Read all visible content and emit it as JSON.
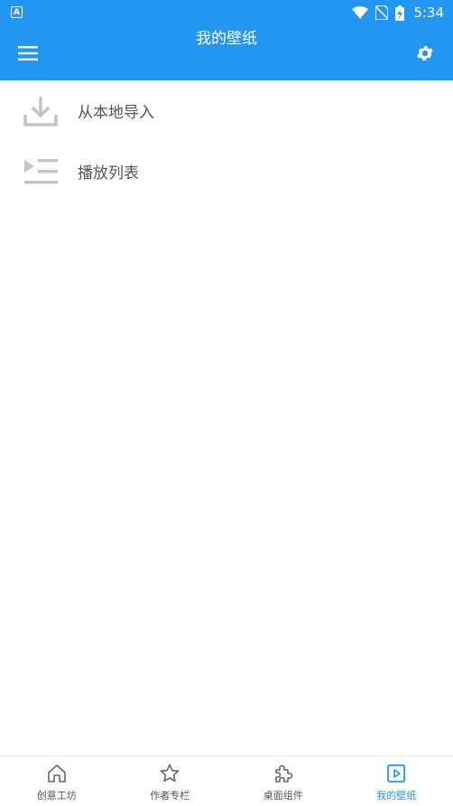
{
  "status_bar": {
    "notification_icon": "A",
    "time": "5:34"
  },
  "app_bar": {
    "title": "我的壁纸"
  },
  "list": [
    {
      "label": "从本地导入",
      "icon": "download-icon"
    },
    {
      "label": "播放列表",
      "icon": "playlist-icon"
    }
  ],
  "bottom_nav": [
    {
      "label": "创意工坊",
      "icon": "home-icon",
      "active": false
    },
    {
      "label": "作者专栏",
      "icon": "star-icon",
      "active": false
    },
    {
      "label": "桌面组件",
      "icon": "puzzle-icon",
      "active": false
    },
    {
      "label": "我的壁纸",
      "icon": "play-square-icon",
      "active": true
    }
  ],
  "colors": {
    "primary": "#2196f3",
    "icon_gray": "#bdbdbd",
    "text_gray": "#555555"
  }
}
